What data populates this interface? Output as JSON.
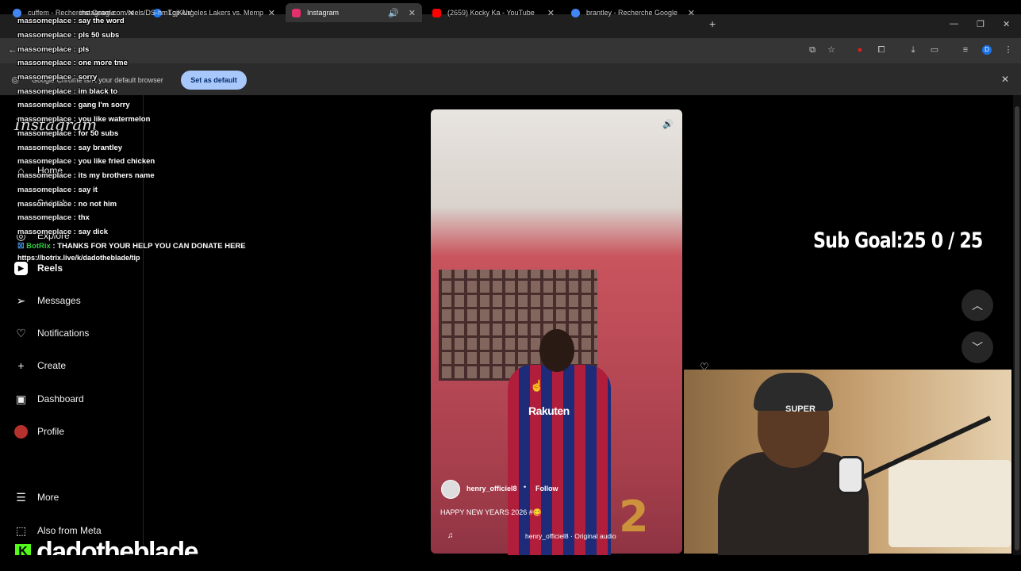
{
  "browser": {
    "tabs": [
      {
        "title": "cuffem - Recherche Google",
        "favicon_color": "#4285f4"
      },
      {
        "title": "Los Angeles Lakers vs. Memphis",
        "favicon_color": "#1877f2"
      },
      {
        "title": "Instagram",
        "favicon_color": "#e1306c"
      },
      {
        "title": "(2659) Kocky Ka - YouTube",
        "favicon_color": "#ff0000"
      },
      {
        "title": "brantley - Recherche Google",
        "favicon_color": "#4285f4"
      }
    ],
    "new_tab": "+",
    "url": "instagram.com/reels/DS-hmTgjKUr/",
    "infobar_text": "Google Chrome isn't your default browser",
    "set_default_label": "Set as default",
    "profile_initial": "D"
  },
  "sidebar": {
    "logo": "Instagram",
    "items": [
      {
        "label": "Home",
        "icon": "home-icon"
      },
      {
        "label": "Search",
        "icon": "search-icon"
      },
      {
        "label": "Explore",
        "icon": "compass-icon"
      },
      {
        "label": "Reels",
        "icon": "reels-icon"
      },
      {
        "label": "Messages",
        "icon": "send-icon"
      },
      {
        "label": "Notifications",
        "icon": "heart-icon"
      },
      {
        "label": "Create",
        "icon": "plus-icon"
      },
      {
        "label": "Dashboard",
        "icon": "dashboard-icon"
      },
      {
        "label": "Profile",
        "icon": "avatar-icon"
      }
    ],
    "more": "More",
    "meta": "Also from Meta"
  },
  "reel": {
    "username": "henry_officiel8",
    "dot": "•",
    "follow": "Follow",
    "caption": "HAPPY NEW YEARS 2026 #😋",
    "audio": "henry_officiel8 · Original audio",
    "shirt_text": "Rakuten",
    "badge": "2"
  },
  "overlay": {
    "sub_goal": "Sub Goal:25  0 / 25",
    "chat": [
      {
        "user": "massomeplace",
        "msg": "say the word"
      },
      {
        "user": "massomeplace",
        "msg": "pls 50 subs"
      },
      {
        "user": "massomeplace",
        "msg": "pls"
      },
      {
        "user": "massomeplace",
        "msg": "one more tme"
      },
      {
        "user": "massomeplace",
        "msg": "sorry"
      },
      {
        "user": "massomeplace",
        "msg": "im black to"
      },
      {
        "user": "massomeplace",
        "msg": "gang I'm sorry"
      },
      {
        "user": "massomeplace",
        "msg": "you like watermelon"
      },
      {
        "user": "massomeplace",
        "msg": "for 50 subs"
      },
      {
        "user": "massomeplace",
        "msg": "say brantley"
      },
      {
        "user": "massomeplace",
        "msg": "you like fried chicken"
      },
      {
        "user": "massomeplace",
        "msg": "its my brothers name"
      },
      {
        "user": "massomeplace",
        "msg": "say it"
      },
      {
        "user": "massomeplace",
        "msg": "no not him"
      },
      {
        "user": "massomeplace",
        "msg": "thx"
      },
      {
        "user": "massomeplace",
        "msg": "say dick"
      }
    ],
    "bot": {
      "user": "BotRix",
      "msg": "THANKS FOR YOUR HELP YOU CAN DONATE HERE"
    },
    "bot_link": "https://botrix.live/k/dadotheblade/tip",
    "streamer": "dadotheblade",
    "kick_logo": "K",
    "beanie_text": "SUPER"
  }
}
